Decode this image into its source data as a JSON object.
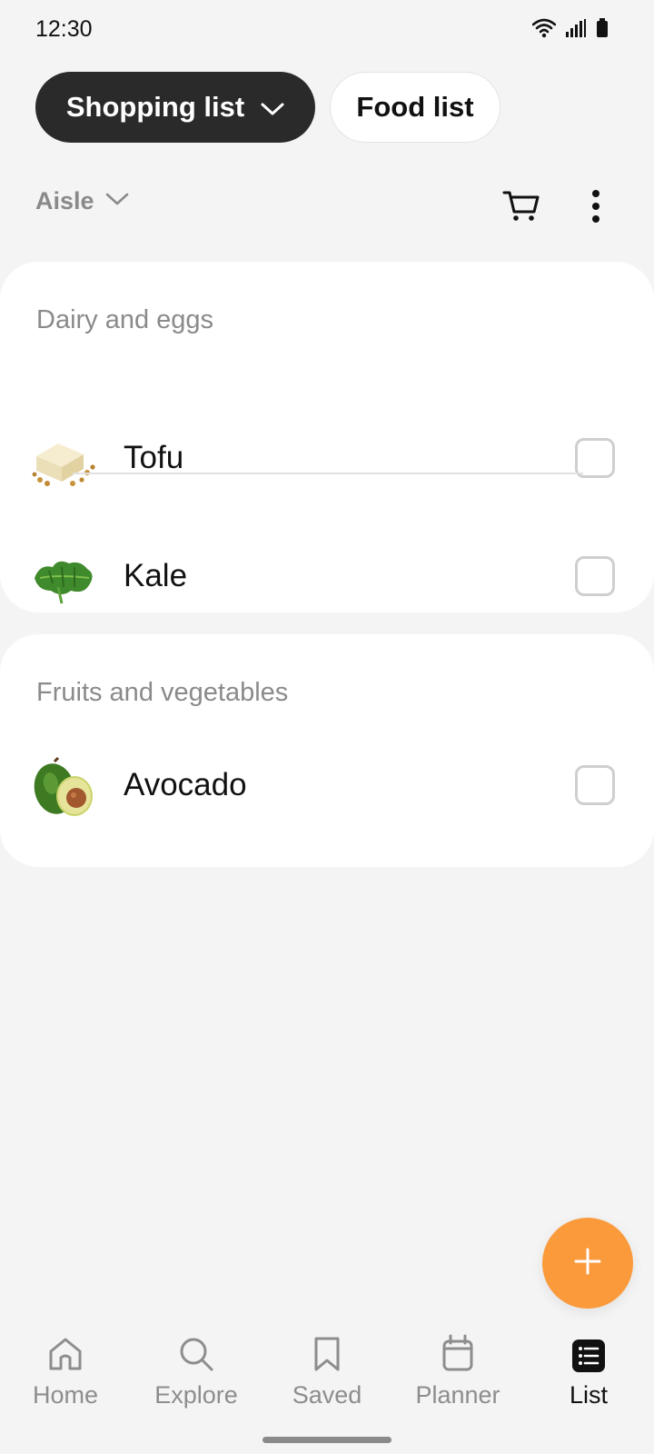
{
  "status_bar": {
    "time": "12:30",
    "icons": [
      "wifi-icon",
      "signal-icon",
      "battery-icon"
    ]
  },
  "tabs": {
    "active_label": "Shopping list",
    "inactive_label": "Food list"
  },
  "sort": {
    "label": "Aisle"
  },
  "toolbar": {
    "icons": [
      "cart-icon",
      "more-vertical-icon"
    ]
  },
  "sections": [
    {
      "title": "Dairy and eggs",
      "items": [
        {
          "name": "Tofu",
          "checked": false
        },
        {
          "name": "Kale",
          "checked": false
        }
      ]
    },
    {
      "title": "Fruits and vegetables",
      "items": [
        {
          "name": "Avocado",
          "checked": false
        }
      ]
    }
  ],
  "fab": {
    "icon": "plus-icon"
  },
  "bottom_nav": {
    "items": [
      {
        "label": "Home",
        "icon": "home-icon"
      },
      {
        "label": "Explore",
        "icon": "search-icon"
      },
      {
        "label": "Saved",
        "icon": "bookmark-icon"
      },
      {
        "label": "Planner",
        "icon": "calendar-icon"
      },
      {
        "label": "List",
        "icon": "list-icon"
      }
    ],
    "active": "List"
  },
  "colors": {
    "accent": "#fa9a3b",
    "active_tab_bg": "#2a2a2a",
    "background": "#f4f4f4"
  }
}
